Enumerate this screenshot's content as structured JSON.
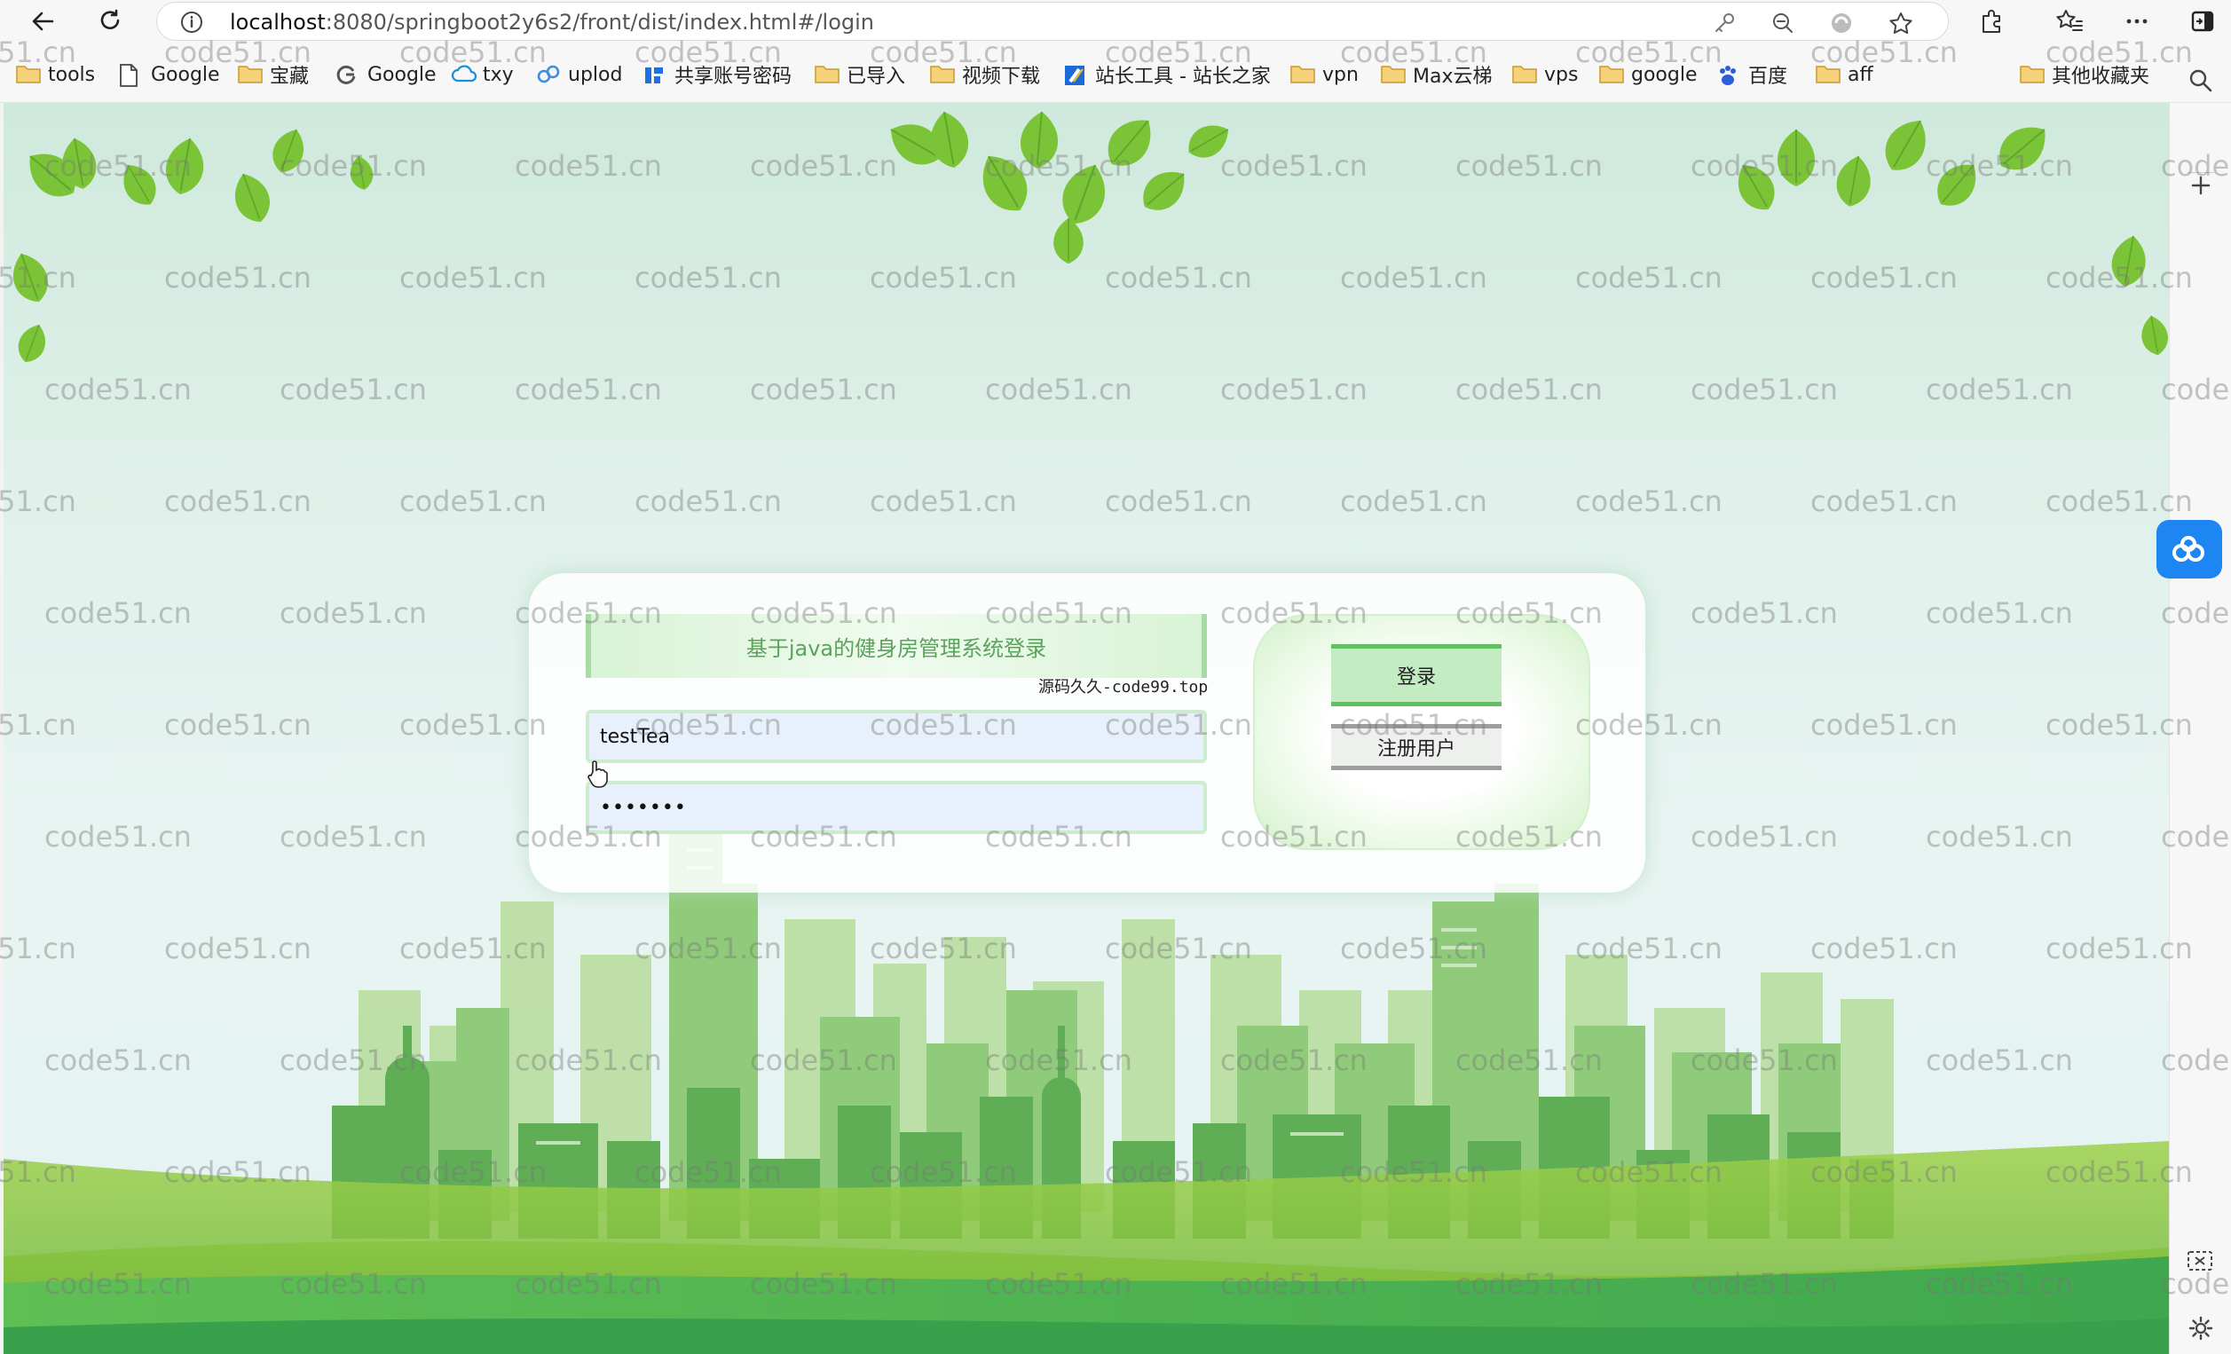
{
  "browser": {
    "url_host": "localhost",
    "url_path": ":8080/springboot2y6s2/front/dist/index.html#/login",
    "icons": [
      "back-icon",
      "reload-icon",
      "site-info-icon",
      "key-icon",
      "zoom-out-icon",
      "copilot-icon",
      "favorite-star-icon",
      "extensions-icon",
      "favorites-icon",
      "more-icon",
      "sidebar-toggle-icon"
    ]
  },
  "bookmarks": [
    {
      "label": "tools",
      "icon": "folder-icon"
    },
    {
      "label": "Google",
      "icon": "page-icon"
    },
    {
      "label": "宝藏",
      "icon": "folder-icon"
    },
    {
      "label": "Google",
      "icon": "google-icon"
    },
    {
      "label": "txy",
      "icon": "cloud-icon"
    },
    {
      "label": "uplod",
      "icon": "cloud-upload-icon"
    },
    {
      "label": "共享账号密码",
      "icon": "share-icon"
    },
    {
      "label": "已导入",
      "icon": "folder-icon"
    },
    {
      "label": "视频下载",
      "icon": "folder-icon"
    },
    {
      "label": "站长工具 - 站长之家",
      "icon": "chinaz-icon"
    },
    {
      "label": "vpn",
      "icon": "folder-icon"
    },
    {
      "label": "Max云梯",
      "icon": "folder-icon"
    },
    {
      "label": "vps",
      "icon": "folder-icon"
    },
    {
      "label": "google",
      "icon": "folder-icon"
    },
    {
      "label": "百度",
      "icon": "baidu-icon"
    },
    {
      "label": "aff",
      "icon": "folder-icon"
    },
    {
      "label": "其他收藏夹",
      "icon": "folder-icon"
    }
  ],
  "login": {
    "title": "基于java的健身房管理系统登录",
    "source_note": "源码久久-code99.top",
    "username": "testTea",
    "password_mask": "•••••••",
    "login_label": "登录",
    "register_label": "注册用户"
  },
  "watermark_text": "code51.cn",
  "colors": {
    "accent_green": "#5fbf62",
    "title_green": "#5aa35a",
    "float_blue": "#1d86f2"
  }
}
